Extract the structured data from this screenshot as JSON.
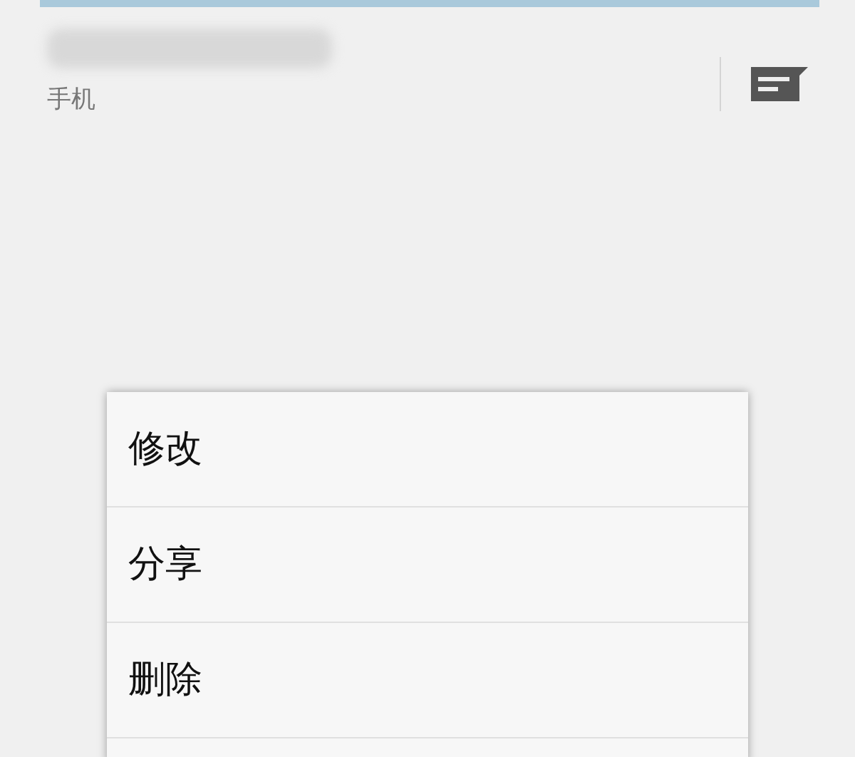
{
  "contact": {
    "phone_type": "手机"
  },
  "menu": {
    "items": [
      {
        "label": "修改"
      },
      {
        "label": "分享"
      },
      {
        "label": "删除"
      }
    ]
  }
}
